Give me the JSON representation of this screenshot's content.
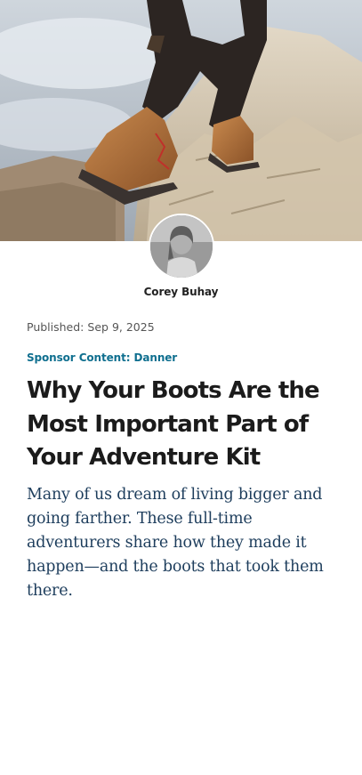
{
  "hero": {
    "image": "hiker-boots-on-rock-photo"
  },
  "author": {
    "avatar": "author-portrait-photo",
    "name": "Corey Buhay"
  },
  "article": {
    "published_label": "Published:",
    "published_date": "Sep 9, 2025",
    "sponsor": "Sponsor Content: Danner",
    "headline": "Why Your Boots Are the Most Important Part of Your Adventure Kit",
    "dek": "Many of us dream of living bigger and going farther. These full-time adventurers share how they made it happen—and the boots that took them there."
  },
  "colors": {
    "sponsor": "#0f6f8f",
    "headline": "#1b1b1b",
    "dek": "#1d3d5c"
  }
}
